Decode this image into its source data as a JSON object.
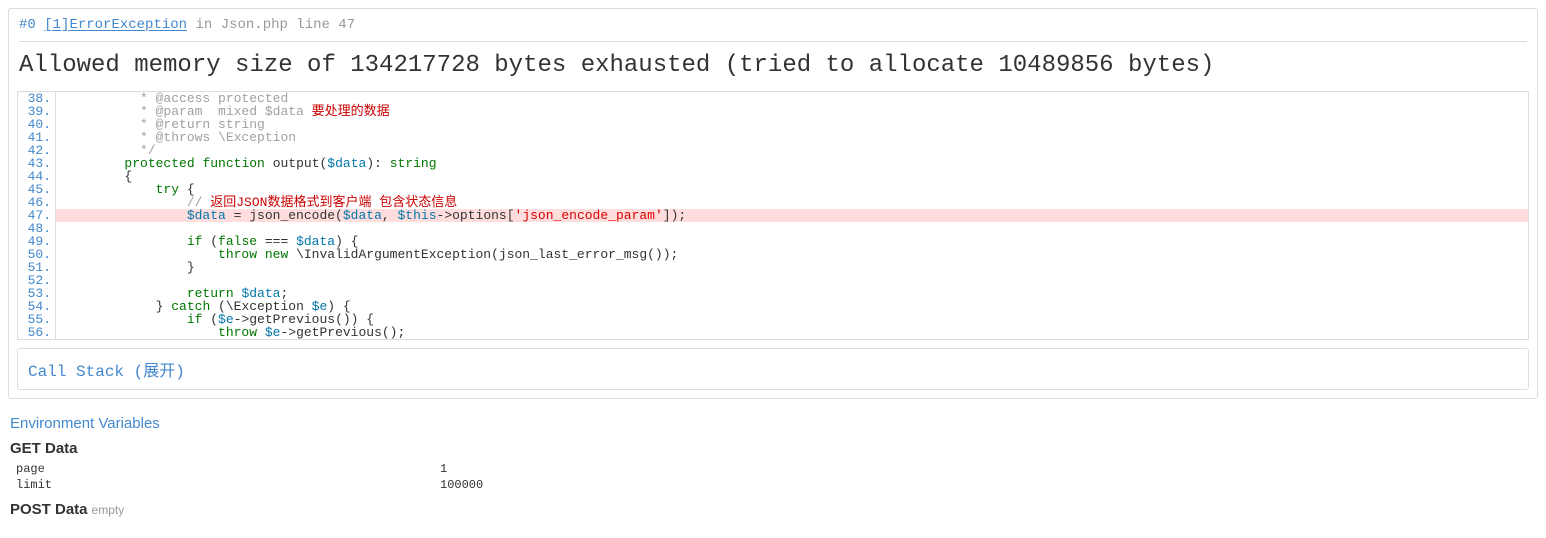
{
  "header": {
    "index": "#0",
    "errnum": "[1]",
    "errclass": "ErrorException",
    "in": "in",
    "location": "Json.php line 47"
  },
  "message": "Allowed memory size of 134217728 bytes exhausted (tried to allocate 10489856 bytes)",
  "code": {
    "start": 38,
    "highlight": 47,
    "lines": [
      {
        "n": 38,
        "pre": "          ",
        "seg": [
          [
            "comment",
            "* @access protected"
          ]
        ]
      },
      {
        "n": 39,
        "pre": "          ",
        "seg": [
          [
            "comment",
            "* @param  mixed $data "
          ],
          [
            "cn",
            "要处理的数据"
          ]
        ]
      },
      {
        "n": 40,
        "pre": "          ",
        "seg": [
          [
            "comment",
            "* @return string"
          ]
        ]
      },
      {
        "n": 41,
        "pre": "          ",
        "seg": [
          [
            "comment",
            "* @throws \\Exception"
          ]
        ]
      },
      {
        "n": 42,
        "pre": "          ",
        "seg": [
          [
            "comment",
            "*/"
          ]
        ]
      },
      {
        "n": 43,
        "pre": "        ",
        "seg": [
          [
            "kw",
            "protected"
          ],
          [
            "",
            ": "
          ],
          [
            "kw",
            "function"
          ],
          [
            "",
            ": "
          ],
          [
            "",
            "output("
          ],
          [
            "var",
            "$data"
          ],
          [
            "",
            "): "
          ],
          [
            "kw",
            "string"
          ]
        ]
      },
      {
        "n": 44,
        "pre": "        ",
        "seg": [
          [
            "",
            "{"
          ]
        ]
      },
      {
        "n": 45,
        "pre": "            ",
        "seg": [
          [
            "kw",
            "try"
          ],
          [
            "",
            " {"
          ]
        ]
      },
      {
        "n": 46,
        "pre": "                ",
        "seg": [
          [
            "comment",
            "// "
          ],
          [
            "cn",
            "返回JSON数据格式到客户端 包含状态信息"
          ]
        ]
      },
      {
        "n": 47,
        "pre": "                ",
        "seg": [
          [
            "var",
            "$data"
          ],
          [
            "",
            " = json_encode("
          ],
          [
            "var",
            "$data"
          ],
          [
            "",
            ", "
          ],
          [
            "var",
            "$this"
          ],
          [
            "",
            "->options["
          ],
          [
            "str",
            "'json_encode_param'"
          ],
          [
            "",
            "]);"
          ]
        ]
      },
      {
        "n": 48,
        "pre": "",
        "seg": []
      },
      {
        "n": 49,
        "pre": "                ",
        "seg": [
          [
            "kw",
            "if"
          ],
          [
            "",
            " ("
          ],
          [
            "kw",
            "false"
          ],
          [
            "",
            " === "
          ],
          [
            "var",
            "$data"
          ],
          [
            "",
            ") {"
          ]
        ]
      },
      {
        "n": 50,
        "pre": "                    ",
        "seg": [
          [
            "kw",
            "throw"
          ],
          [
            "",
            " "
          ],
          [
            "kw",
            "new"
          ],
          [
            "",
            " \\InvalidArgumentException(json_last_error_msg());"
          ]
        ]
      },
      {
        "n": 51,
        "pre": "                ",
        "seg": [
          [
            "",
            "}"
          ]
        ]
      },
      {
        "n": 52,
        "pre": "",
        "seg": []
      },
      {
        "n": 53,
        "pre": "                ",
        "seg": [
          [
            "kw",
            "return"
          ],
          [
            "",
            " "
          ],
          [
            "var",
            "$data"
          ],
          [
            "",
            ";"
          ]
        ]
      },
      {
        "n": 54,
        "pre": "            ",
        "seg": [
          [
            "",
            "} "
          ],
          [
            "kw",
            "catch"
          ],
          [
            "",
            " (\\Exception "
          ],
          [
            "var",
            "$e"
          ],
          [
            "",
            ") {"
          ]
        ]
      },
      {
        "n": 55,
        "pre": "                ",
        "seg": [
          [
            "kw",
            "if"
          ],
          [
            "",
            " ("
          ],
          [
            "var",
            "$e"
          ],
          [
            "",
            "->getPrevious()) {"
          ]
        ]
      },
      {
        "n": 56,
        "pre": "                    ",
        "seg": [
          [
            "kw",
            "throw"
          ],
          [
            "",
            " "
          ],
          [
            "var",
            "$e"
          ],
          [
            "",
            "->getPrevious();"
          ]
        ]
      }
    ]
  },
  "callstack": {
    "title": "Call Stack",
    "toggle": "(展开)"
  },
  "env": {
    "title": "Environment Variables"
  },
  "get": {
    "title": "GET Data",
    "rows": [
      {
        "k": "page",
        "v": "1"
      },
      {
        "k": "limit",
        "v": "100000"
      }
    ]
  },
  "post": {
    "title": "POST Data",
    "empty": "empty"
  }
}
